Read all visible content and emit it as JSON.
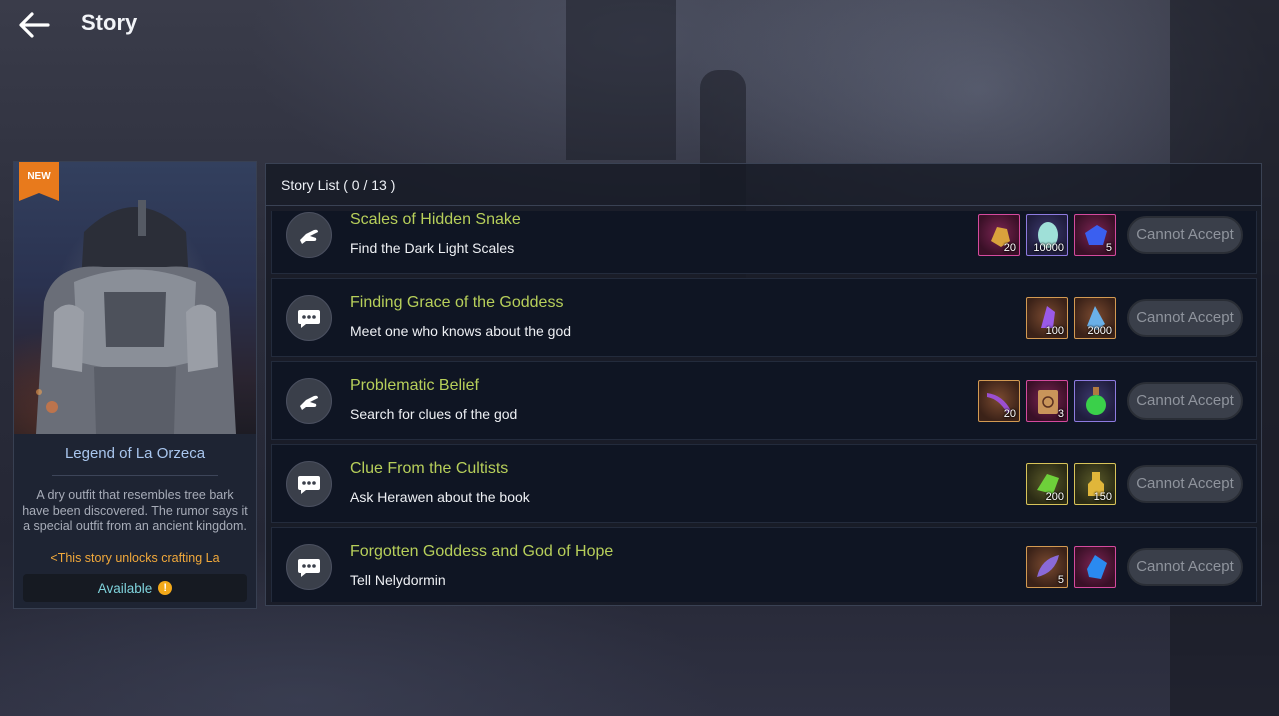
{
  "header": {
    "back_label": "back",
    "title": "Story"
  },
  "card": {
    "badge": "NEW",
    "name": "Legend of La Orzeca",
    "description": "A dry outfit that resembles tree bark have been discovered. The rumor says it a special outfit from an ancient kingdom.",
    "unlock_text": "<This story unlocks crafting La",
    "status_label": "Available",
    "status_icon": "!"
  },
  "story_list": {
    "title": "Story List ( 0 / 13 )",
    "items": [
      {
        "title": "Scales of Hidden Snake",
        "subtitle": "Find the Dark Light Scales",
        "icon": "hand-icon",
        "button": "Cannot Accept",
        "rewards": [
          {
            "icon": "gold-ore-icon",
            "qty": "20"
          },
          {
            "icon": "egg-icon",
            "qty": "10000"
          },
          {
            "icon": "blue-crystal-icon",
            "qty": "5"
          }
        ]
      },
      {
        "title": "Finding Grace of the Goddess",
        "subtitle": "Meet one who knows about the god",
        "icon": "chat-icon",
        "button": "Cannot Accept",
        "rewards": [
          {
            "icon": "purple-crystal-icon",
            "qty": "100"
          },
          {
            "icon": "blue-shard-icon",
            "qty": "2000"
          }
        ]
      },
      {
        "title": "Problematic Belief",
        "subtitle": "Search for clues of the god",
        "icon": "hand-icon",
        "button": "Cannot Accept",
        "rewards": [
          {
            "icon": "horn-icon",
            "qty": "20"
          },
          {
            "icon": "scroll-icon",
            "qty": "3"
          },
          {
            "icon": "potion-icon",
            "qty": ""
          }
        ]
      },
      {
        "title": "Clue From the Cultists",
        "subtitle": "Ask Herawen about the book",
        "icon": "chat-icon",
        "button": "Cannot Accept",
        "rewards": [
          {
            "icon": "green-crystal-icon",
            "qty": "200"
          },
          {
            "icon": "gold-idol-icon",
            "qty": "150"
          }
        ]
      },
      {
        "title": "Forgotten Goddess and God of Hope",
        "subtitle": "Tell Nelydormin",
        "icon": "chat-icon",
        "button": "Cannot Accept",
        "rewards": [
          {
            "icon": "feather-icon",
            "qty": "5"
          },
          {
            "icon": "sapphire-icon",
            "qty": ""
          }
        ]
      }
    ]
  }
}
